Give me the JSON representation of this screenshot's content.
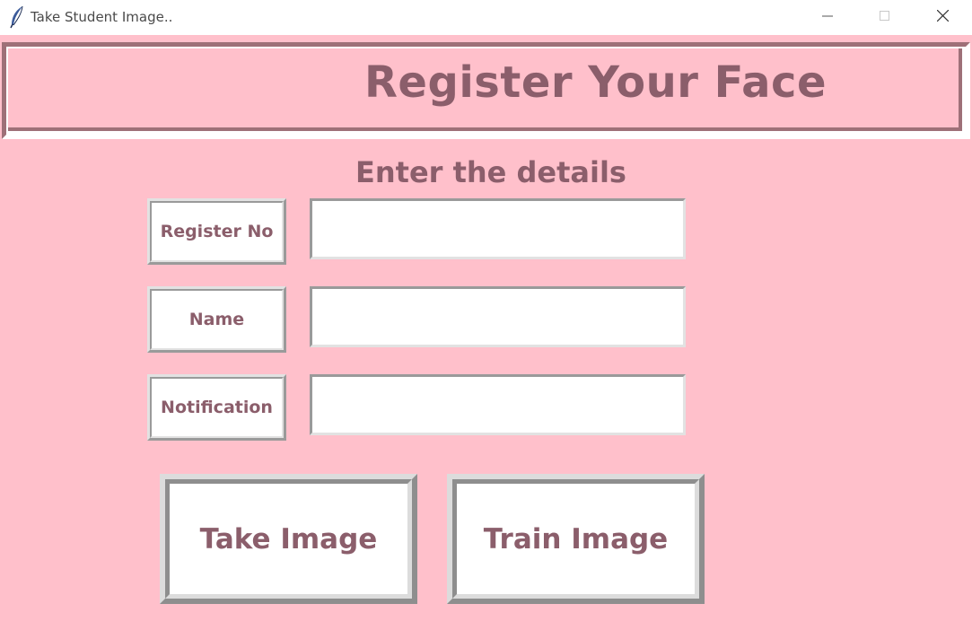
{
  "window": {
    "title": "Take Student Image..",
    "icon": "feather-icon",
    "controls": [
      "minimize-icon",
      "maximize-icon",
      "close-icon"
    ]
  },
  "colors": {
    "background": "#ffc0cb",
    "text": "#8b5e6b",
    "border_dark": "#9e7078"
  },
  "header": {
    "title": "Register Your Face"
  },
  "form": {
    "heading": "Enter the details",
    "fields": [
      {
        "label": "Register No",
        "value": "",
        "placeholder": ""
      },
      {
        "label": "Name",
        "value": "",
        "placeholder": ""
      },
      {
        "label": "Notification",
        "value": "",
        "placeholder": ""
      }
    ]
  },
  "buttons": {
    "take_image": "Take Image",
    "train_image": "Train Image"
  }
}
